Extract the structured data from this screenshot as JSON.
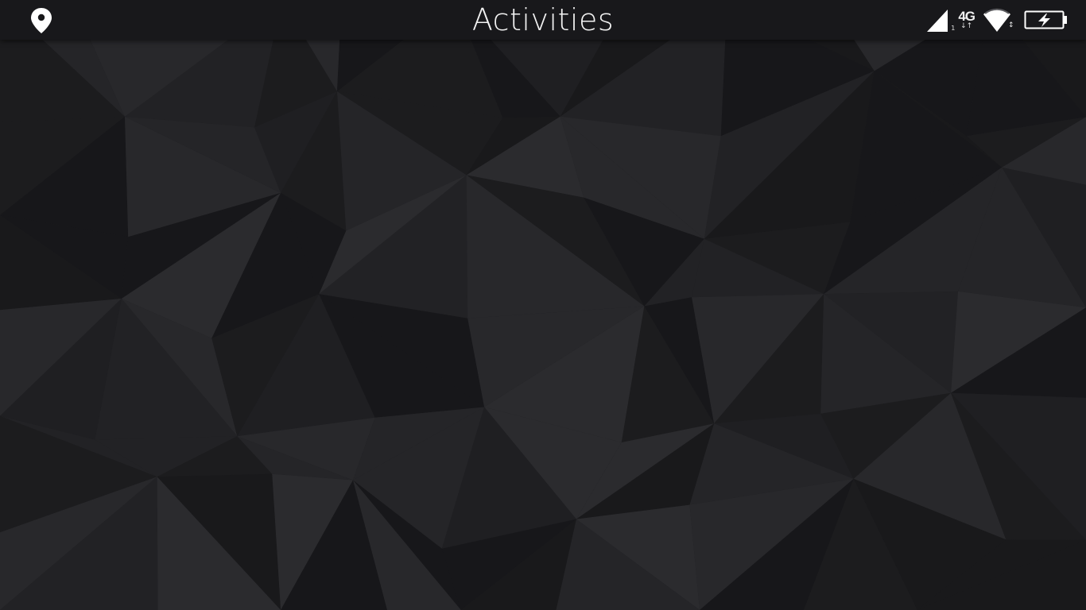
{
  "top_bar": {
    "title": "Activities",
    "left_icon": "location-pin-icon",
    "status": {
      "signal_icon": "cellular-signal-icon",
      "sim_index": "1",
      "network_type": "4G",
      "data_arrows": "↓↑",
      "wifi_icon": "wifi-icon",
      "battery_icon": "battery-charging-icon"
    }
  },
  "wallpaper": {
    "style": "dark low-poly triangles",
    "base_color": "#1f1f22"
  },
  "colors": {
    "bar_background": "#18181b",
    "text": "#f2f2f2"
  }
}
